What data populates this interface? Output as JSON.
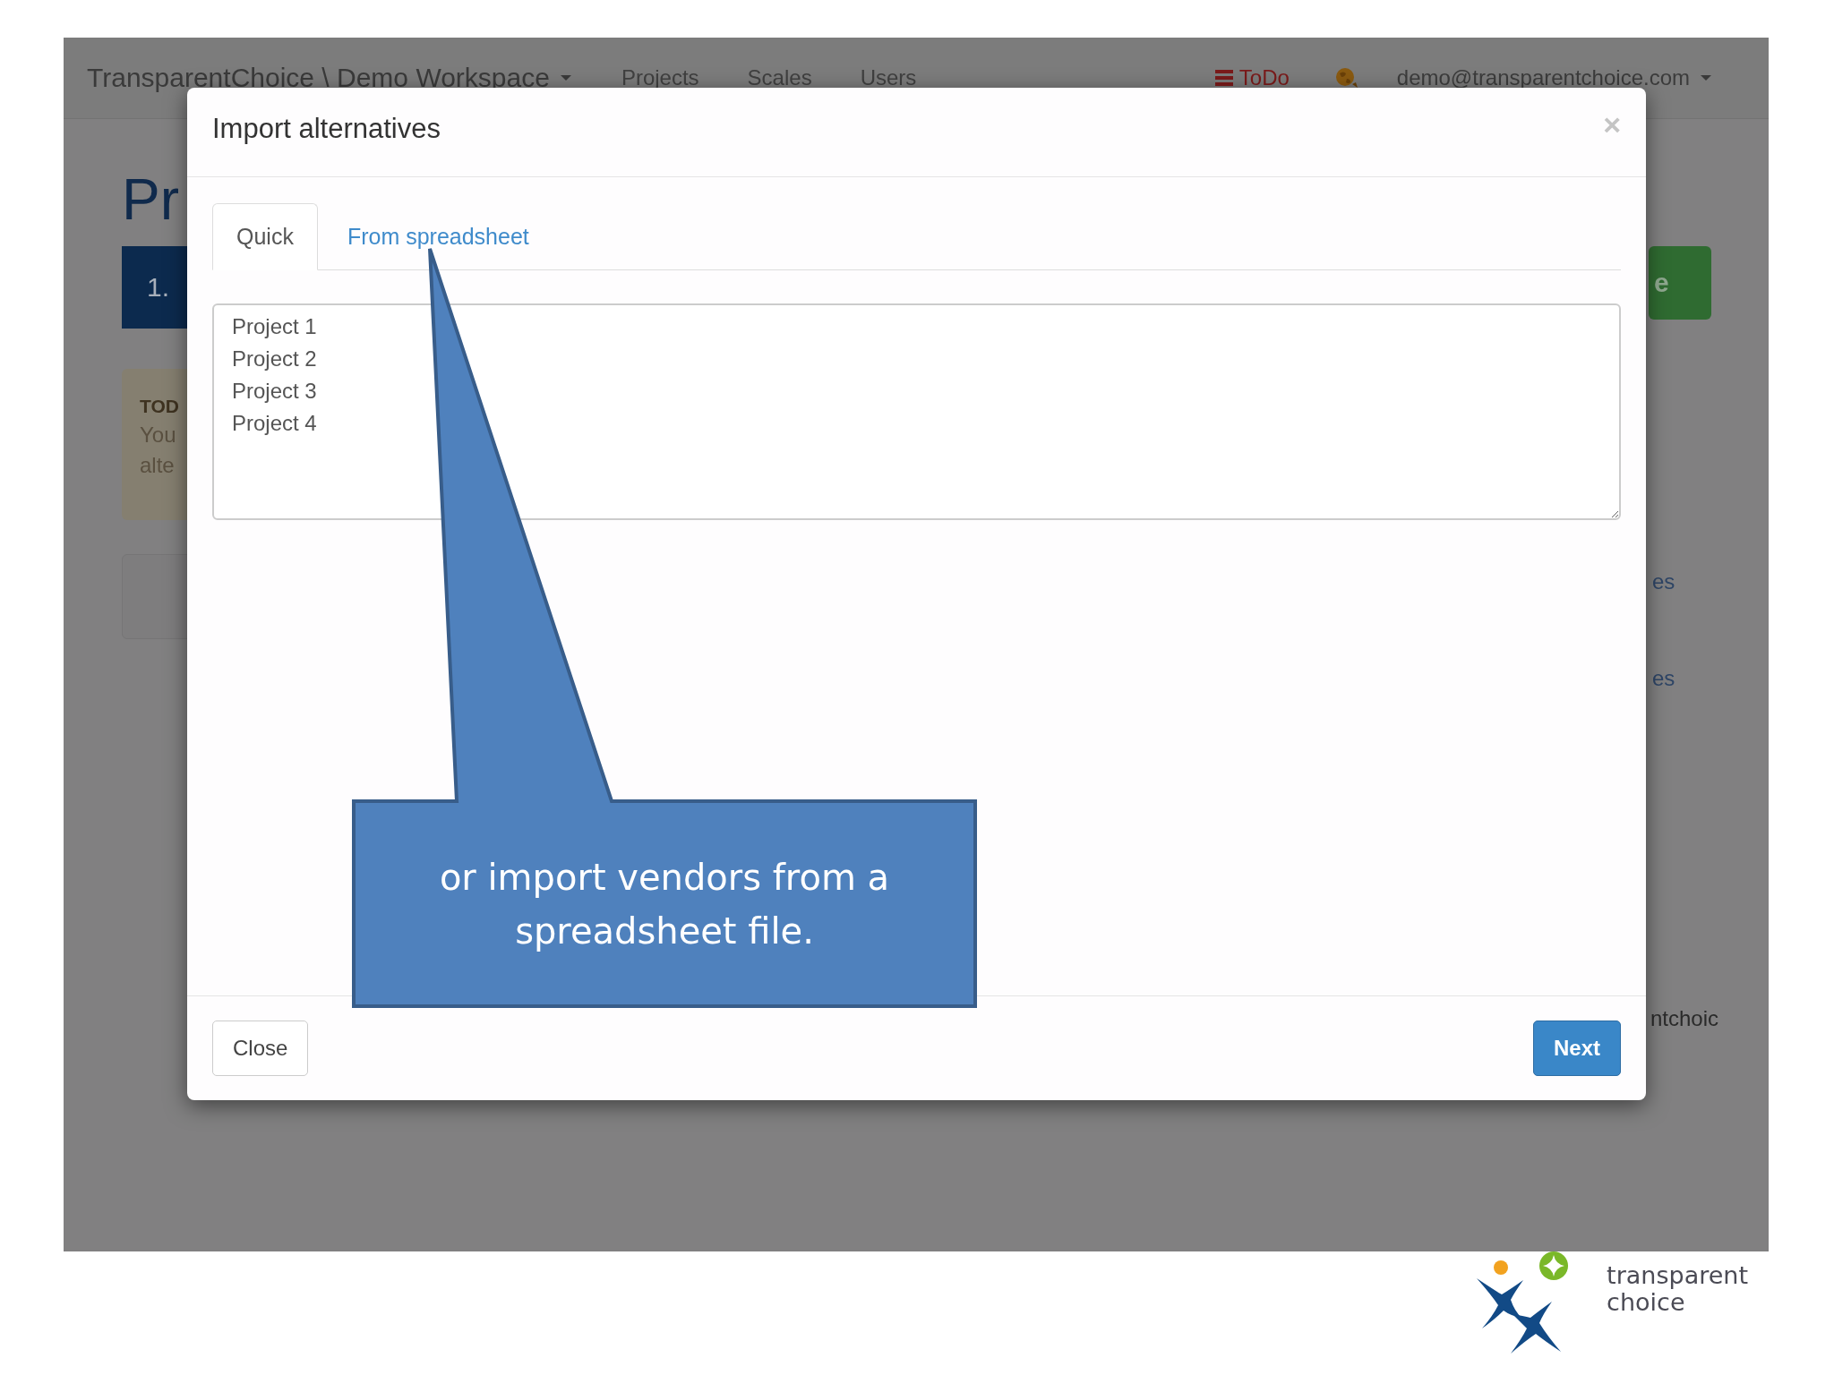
{
  "navbar": {
    "brand": "TransparentChoice \\ Demo Workspace",
    "links": [
      "Projects",
      "Scales",
      "Users"
    ],
    "todo": "ToDo",
    "user": "demo@transparentchoice.com"
  },
  "background_page": {
    "heading": "Pr",
    "step_bar": "1.",
    "todo_box": {
      "title": "TOD",
      "lines": [
        "You",
        "alte"
      ]
    },
    "action_button": "e",
    "links": [
      "es",
      "es"
    ],
    "footer": "ntchoic"
  },
  "modal": {
    "title": "Import alternatives",
    "close": "×",
    "tabs": [
      {
        "label": "Quick",
        "selected": true
      },
      {
        "label": "From spreadsheet",
        "selected": false
      }
    ],
    "textarea": {
      "value": "Project 1\nProject 2\nProject 3\nProject 4"
    },
    "buttons": [
      {
        "label": "Close",
        "kind": "default"
      },
      {
        "label": "Next",
        "kind": "primary"
      }
    ]
  },
  "callout": {
    "text": "or import vendors from a spreadsheet file."
  },
  "logo": {
    "lines": [
      "transparent",
      "choice"
    ]
  }
}
